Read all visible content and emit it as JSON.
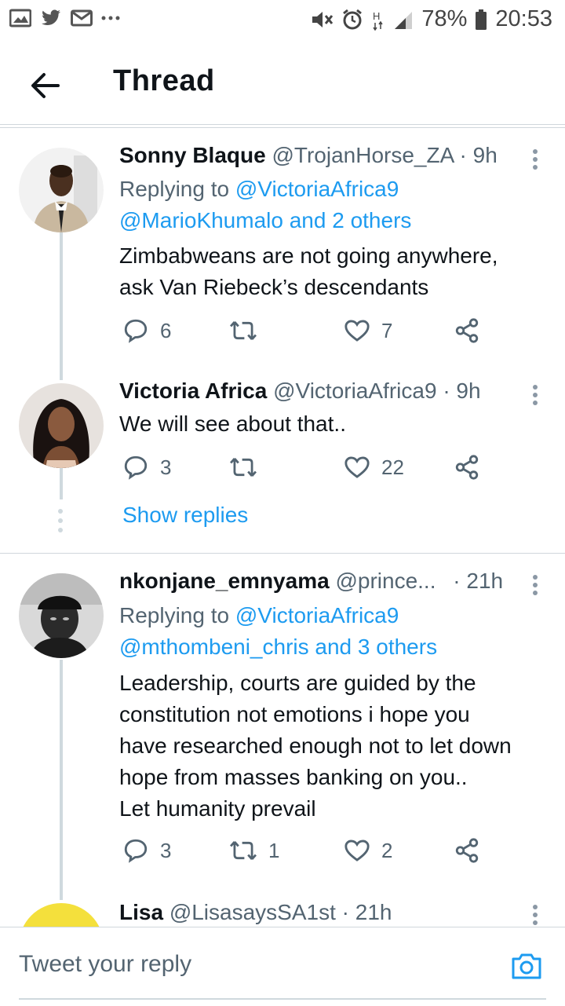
{
  "status_bar": {
    "battery": "78%",
    "time": "20:53",
    "left_icons": [
      "gallery-icon",
      "twitter-bird-icon",
      "mail-icon",
      "more-dots-icon"
    ],
    "right_icons": [
      "mute-icon",
      "alarm-icon",
      "network-h-icon",
      "signal-icon",
      "battery-icon"
    ]
  },
  "header": {
    "title": "Thread"
  },
  "tweets": [
    {
      "name": "Sonny Blaque",
      "handle": "@TrojanHorse_ZA",
      "time": "· 9h",
      "replying_prefix": "Replying to ",
      "replying_line1": "@VictoriaAfrica9",
      "replying_line2": "@MarioKhumalo and 2 others",
      "text_lines": [
        "Zimbabweans are not going anywhere,",
        "ask Van Riebeck’s descendants"
      ],
      "replies": "6",
      "retweets": "",
      "likes": "7"
    },
    {
      "name": "Victoria Africa",
      "handle": "@VictoriaAfrica9",
      "time": "· 9h",
      "text_lines": [
        "We will see about that.."
      ],
      "replies": "3",
      "retweets": "",
      "likes": "22"
    },
    {
      "name": "nkonjane_emnyama",
      "handle": "@prince...",
      "time": "· 21h",
      "replying_prefix": "Replying to ",
      "replying_line1": "@VictoriaAfrica9",
      "replying_line2": "@mthombeni_chris and 3 others",
      "text_lines": [
        "Leadership, courts are guided by the",
        "constitution not emotions i hope you",
        "have researched enough not to let down",
        "hope from masses banking on you..",
        "Let humanity prevail"
      ],
      "replies": "3",
      "retweets": "1",
      "likes": "2"
    },
    {
      "name": "Lisa",
      "handle": "@LisasaysSA1st",
      "time": "· 21h"
    }
  ],
  "show_replies": "Show replies",
  "reply_bar": {
    "placeholder": "Tweet your reply"
  },
  "colors": {
    "accent": "#1d9bf0",
    "muted": "#536471",
    "thread_line": "#cfd9de",
    "lisa_avatar": "#f4e03c"
  }
}
